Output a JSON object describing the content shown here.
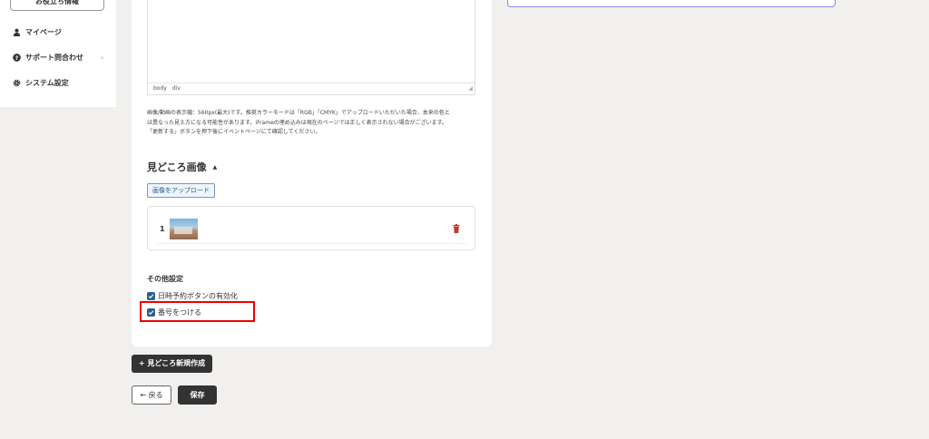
{
  "sidebar": {
    "tips_label": "お役立ち情報",
    "items": [
      {
        "label": "マイページ",
        "icon": "user-icon"
      },
      {
        "label": "サポート問合わせ",
        "icon": "question-circle-icon"
      },
      {
        "label": "システム設定",
        "icon": "gear-icon"
      }
    ],
    "chevron": "›"
  },
  "editor": {
    "status_body": "body",
    "status_div": "div"
  },
  "note": {
    "line1": "画像/動画の表示幅：560px(最大)です。推奨カラーモードは「RGB」「CMYK」でアップロードいただいた場合、本来の色と",
    "line2": "は異なった見え方になる可能性があります。iFrameの埋め込みは現在のページでは正しく表示されない場合がございます。",
    "line3": "「更新する」ボタンを押下後にイベントページにて確認してください。"
  },
  "highlights_section": {
    "title": "見どころ画像",
    "caret": "▲",
    "upload_label": "画像をアップロード",
    "images": [
      {
        "number": "1"
      }
    ]
  },
  "other_settings": {
    "title": "その他設定",
    "options": [
      {
        "label": "日時予約ボタンの有効化",
        "checked": true
      },
      {
        "label": "番号をつける",
        "checked": true
      }
    ]
  },
  "actions": {
    "new_label": "+ 見どころ新規作成",
    "back_label": "← 戻る",
    "save_label": "保存"
  },
  "colors": {
    "accent": "#2e5f8a",
    "highlight_border": "#e00000",
    "dark_button": "#333333",
    "right_panel_border": "#8b86e0"
  }
}
